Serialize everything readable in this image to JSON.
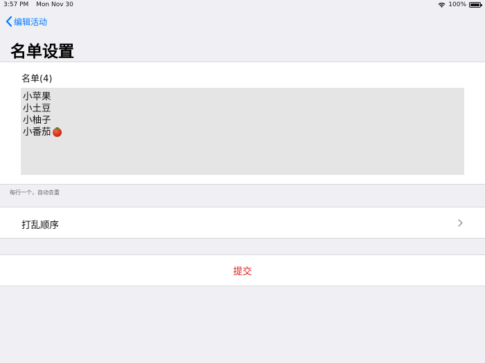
{
  "status_bar": {
    "time": "3:57 PM",
    "date": "Mon Nov 30",
    "battery": "100%"
  },
  "nav": {
    "back_label": "编辑活动",
    "title": "名单设置"
  },
  "list": {
    "label": "名单(4)",
    "items": [
      "小苹果",
      "小土豆",
      "小柚子",
      "小番茄"
    ],
    "textarea_bg": "#e5e5e5"
  },
  "footnote": "每行一个，自动去重",
  "shuffle_row": {
    "label": "打乱顺序",
    "icon": "chevron-right-icon"
  },
  "submit": {
    "label": "提交",
    "color": "#e02020"
  },
  "colors": {
    "accent": "#007aff",
    "background": "#efeff4"
  }
}
